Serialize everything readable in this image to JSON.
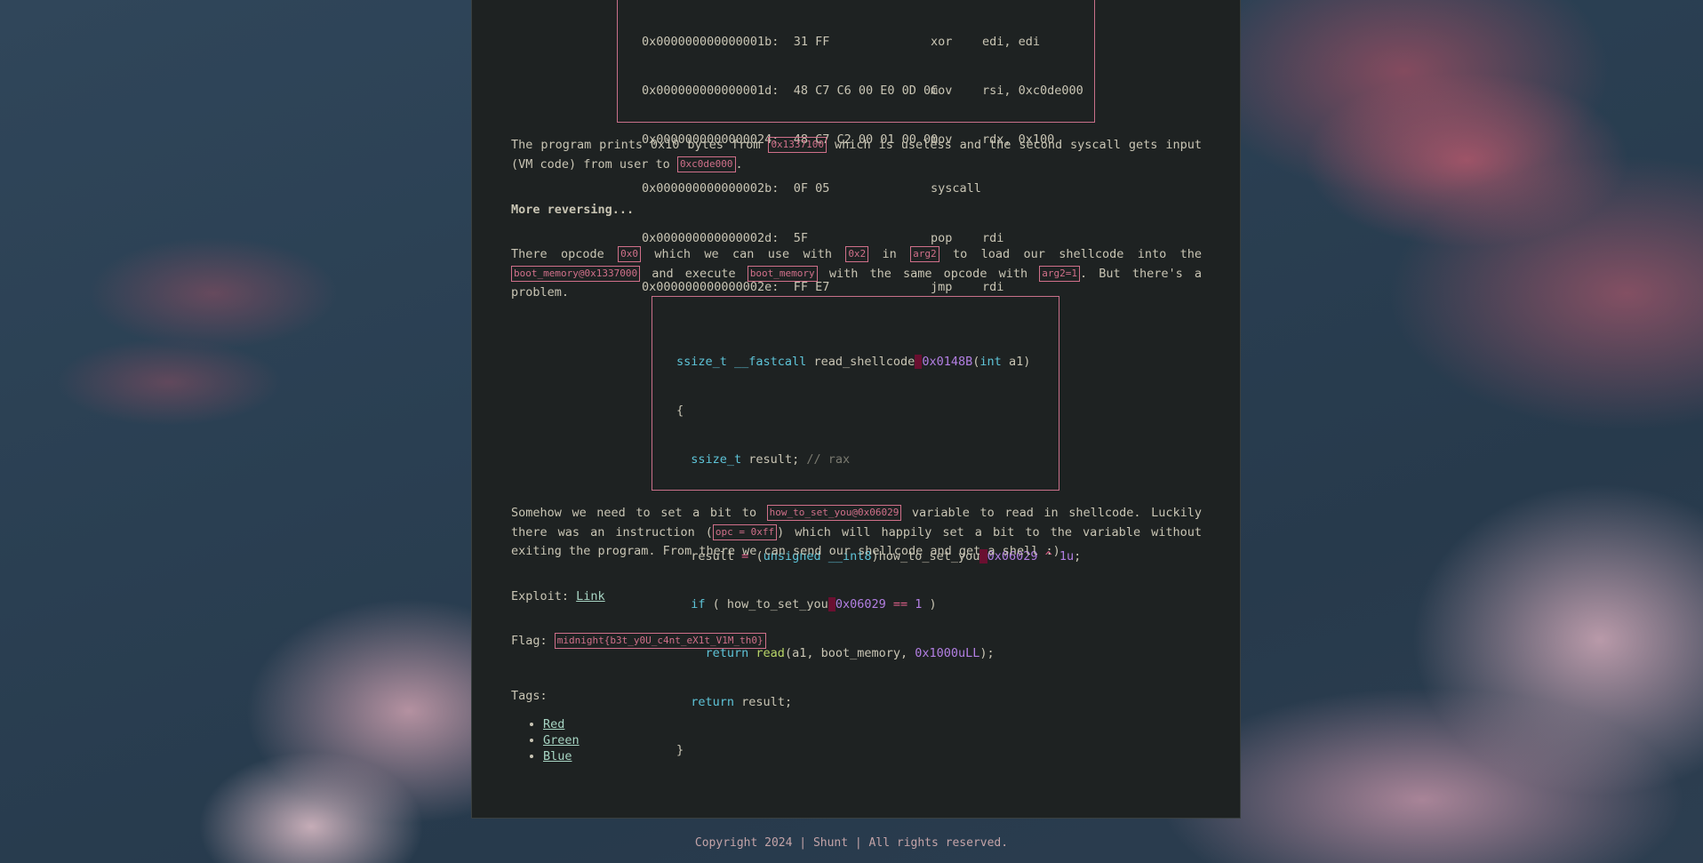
{
  "asm": [
    [
      "0x000000000000001b:",
      "31 FF",
      "xor",
      "edi, edi"
    ],
    [
      "0x000000000000001d:",
      "48 C7 C6 00 E0 0D 0C",
      "mov",
      "rsi, 0xc0de000"
    ],
    [
      "0x0000000000000024:",
      "48 C7 C2 00 01 00 00",
      "mov",
      "rdx, 0x100"
    ],
    [
      "0x000000000000002b:",
      "0F 05",
      "syscall",
      ""
    ],
    [
      "0x000000000000002d:",
      "5F",
      "pop",
      "rdi"
    ],
    [
      "0x000000000000002e:",
      "FF E7",
      "jmp",
      "rdi"
    ]
  ],
  "p1": {
    "t1": "The program prints 0x10 bytes from ",
    "c1": "0x1337100",
    "t2": " which is useless and the second syscall gets input (VM code) from user to ",
    "c2": "0xc0de000",
    "t3": "."
  },
  "heading": "More reversing...",
  "p2": {
    "t1": "There opcode ",
    "c1": "0x0",
    "t2": " which we can use with ",
    "c2": "0x2",
    "t3": " in ",
    "c3": "arg2",
    "t4": " to load our shellcode into the ",
    "c4": "boot_memory@0x1337000",
    "t5": " and execute ",
    "c5": "boot_memory",
    "t6": " with the same opcode with ",
    "c6": "arg2=1",
    "t7": ". But there's a problem."
  },
  "src": {
    "l1": {
      "a": "ssize_t __fastcall",
      "b": " read_shellcode",
      "c": "0x0148B",
      "d": "(",
      "e": "int",
      "f": " a1)"
    },
    "l2": "{",
    "l3": {
      "a": "ssize_t",
      "b": " result; ",
      "c": "// rax"
    },
    "l5": {
      "a": "result ",
      "b": "=",
      "c": " (",
      "d": "unsigned __int8",
      "e": ")how_to_set_you",
      "f": "0x06029",
      "g": " ^ ",
      "h": "1u",
      "i": ";"
    },
    "l6": {
      "a": "if",
      "b": " ( how_to_set_you",
      "c": "0x06029",
      "d": " == ",
      "e": "1",
      "f": " )"
    },
    "l7": {
      "a": "return",
      "b": " read",
      "c": "(a1, boot_memory, ",
      "d": "0x1000uLL",
      "e": ");"
    },
    "l8": {
      "a": "return",
      "b": " result;"
    },
    "l9": "}"
  },
  "p3": {
    "t1": "Somehow we need to set a bit to ",
    "c1": "how_to_set_you@0x06029",
    "t2": " variable to read in shellcode. Luckily there was an instruction (",
    "c2": "opc = 0xff",
    "t3": ") which will happily set a bit to the variable without exiting the program. From there we can send our shellcode and get a shell :)"
  },
  "exploit": {
    "label": "Exploit: ",
    "link": "Link"
  },
  "flag": {
    "label": "Flag: ",
    "value": "midnight{b3t_y0U_c4nt_eX1t_V1M_th0}"
  },
  "tags": {
    "label": "Tags:",
    "items": [
      "Red",
      "Green",
      "Blue"
    ]
  },
  "footer": "Copyright 2024 | Shunt | All rights reserved."
}
